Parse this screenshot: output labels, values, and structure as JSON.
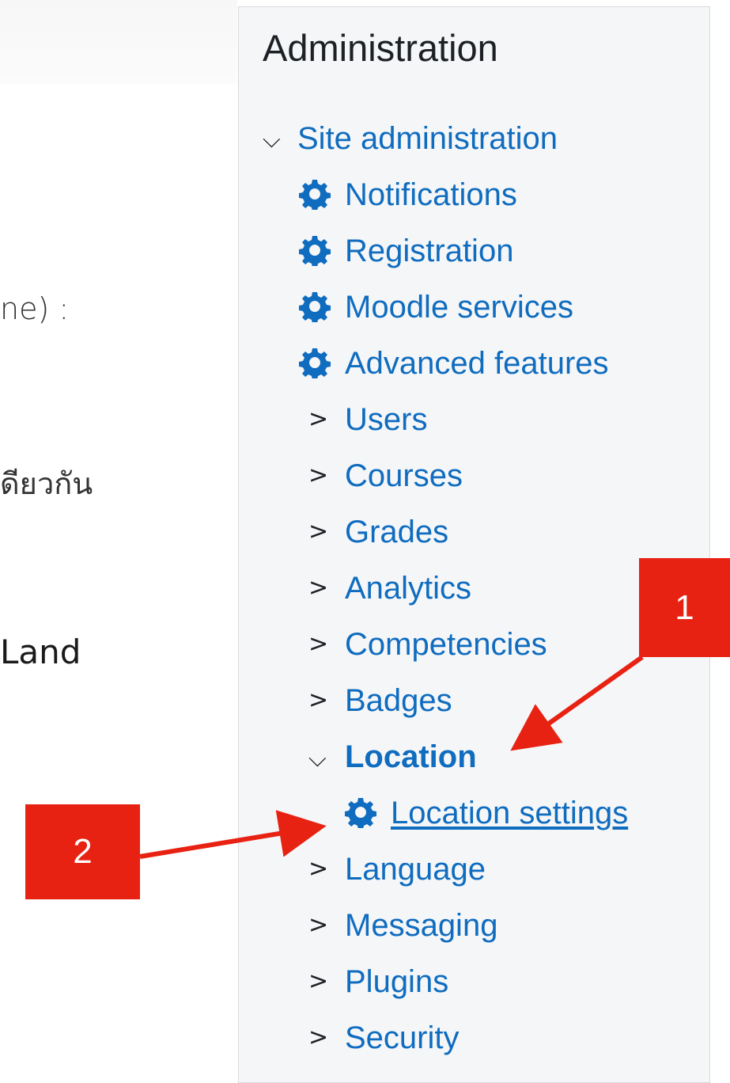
{
  "background_fragments": {
    "line1": "ne) :",
    "line2": "ดียวกัน",
    "line3": "Land"
  },
  "panel": {
    "title": "Administration",
    "root": "Site administration",
    "gear_items": [
      "Notifications",
      "Registration",
      "Moodle services",
      "Advanced features"
    ],
    "collapsed_items": [
      "Users",
      "Courses",
      "Grades",
      "Analytics",
      "Competencies",
      "Badges"
    ],
    "expanded_item": "Location",
    "expanded_child": "Location settings",
    "collapsed_items_after": [
      "Language",
      "Messaging",
      "Plugins",
      "Security"
    ]
  },
  "annotations": {
    "callout_1": "1",
    "callout_2": "2"
  },
  "colors": {
    "link": "#0f6cbf",
    "callout": "#e82212"
  },
  "icons": {
    "expanded": "chevron-down-icon",
    "collapsed": "chevron-right-icon",
    "settings": "gear-icon"
  }
}
